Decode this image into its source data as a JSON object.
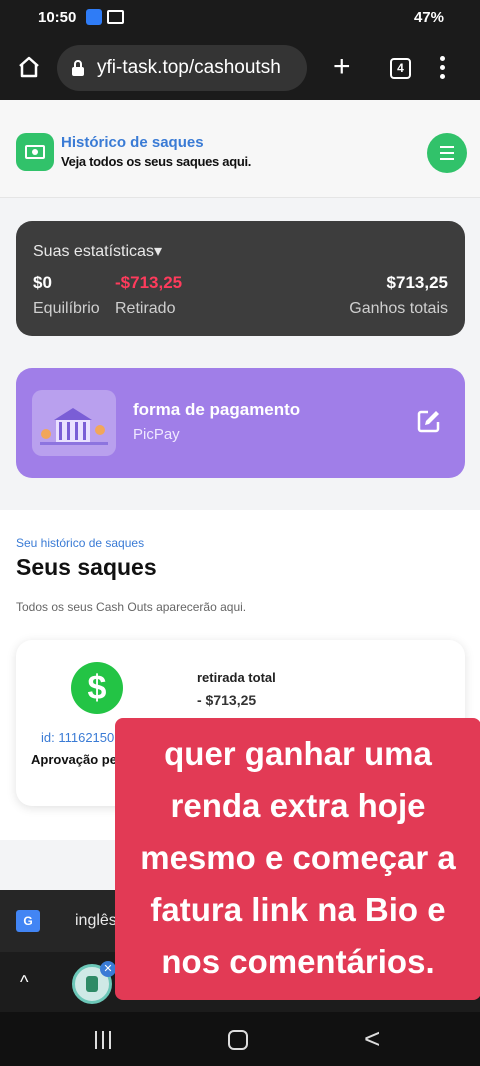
{
  "status_bar": {
    "time": "10:50",
    "battery": "47%"
  },
  "browser": {
    "url": "yfi-task.top/cashoutsh",
    "tab_count": "4"
  },
  "header": {
    "title": "Histórico de saques",
    "subtitle": "Veja todos os seus saques aqui."
  },
  "stats": {
    "label": "Suas estatísticas▾",
    "balance_value": "$0",
    "balance_label": "Equilíbrio",
    "withdrawn_value": "-$713,25",
    "withdrawn_label": "Retirado",
    "earnings_value": "$713,25",
    "earnings_label": "Ganhos totais",
    "colors": {
      "withdrawn": "#ff3b5c",
      "card_bg": "#3d3d3d"
    }
  },
  "payment": {
    "title": "forma de pagamento",
    "method": "PicPay",
    "colors": {
      "card_bg": "#a07ee8"
    }
  },
  "history": {
    "kicker": "Seu histórico de saques",
    "title": "Seus saques",
    "description": "Todos os seus Cash Outs aparecerão aqui.",
    "items": [
      {
        "label": "retirada total",
        "amount": "- $713,25",
        "id": "id: 11162150188",
        "status": "Aprovação pendente"
      }
    ]
  },
  "translate_bar": {
    "language": "inglês"
  },
  "overlay": {
    "lines": [
      "quer ganhar uma",
      "renda extra  hoje",
      "mesmo e começar a",
      "fatura link na Bio e",
      "nos comentários."
    ],
    "color": "#e23a55"
  },
  "icons": {
    "home": "home-icon",
    "lock": "lock-icon",
    "new_tab": "plus-icon",
    "tabs": "tab-switcher-icon",
    "menu": "more-vert-icon",
    "logo": "money-icon",
    "hamburger": "hamburger-icon",
    "edit": "edit-icon",
    "dollar": "dollar-icon",
    "translate": "google-translate-icon"
  }
}
